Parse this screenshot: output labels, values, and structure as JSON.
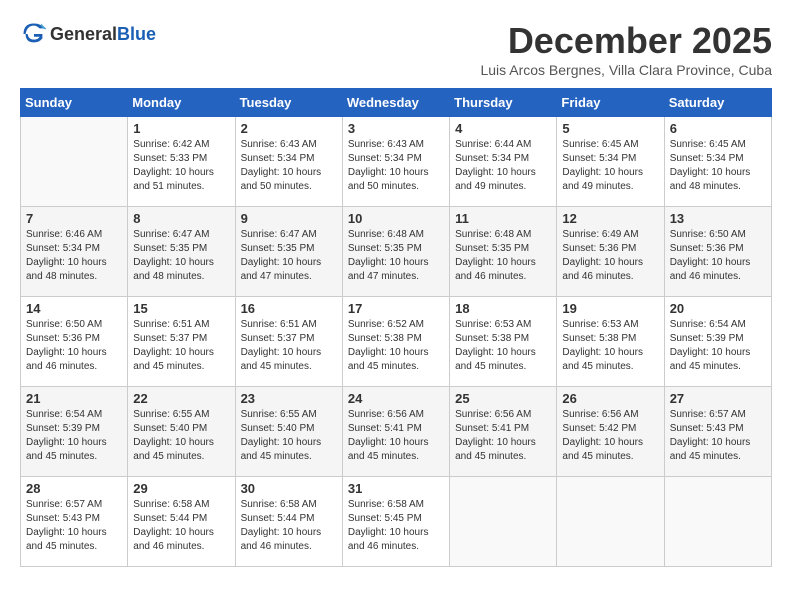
{
  "logo": {
    "text_general": "General",
    "text_blue": "Blue"
  },
  "title": {
    "month": "December 2025",
    "location": "Luis Arcos Bergnes, Villa Clara Province, Cuba"
  },
  "calendar": {
    "headers": [
      "Sunday",
      "Monday",
      "Tuesday",
      "Wednesday",
      "Thursday",
      "Friday",
      "Saturday"
    ],
    "weeks": [
      [
        {
          "day": "",
          "sunrise": "",
          "sunset": "",
          "daylight": ""
        },
        {
          "day": "1",
          "sunrise": "Sunrise: 6:42 AM",
          "sunset": "Sunset: 5:33 PM",
          "daylight": "Daylight: 10 hours and 51 minutes."
        },
        {
          "day": "2",
          "sunrise": "Sunrise: 6:43 AM",
          "sunset": "Sunset: 5:34 PM",
          "daylight": "Daylight: 10 hours and 50 minutes."
        },
        {
          "day": "3",
          "sunrise": "Sunrise: 6:43 AM",
          "sunset": "Sunset: 5:34 PM",
          "daylight": "Daylight: 10 hours and 50 minutes."
        },
        {
          "day": "4",
          "sunrise": "Sunrise: 6:44 AM",
          "sunset": "Sunset: 5:34 PM",
          "daylight": "Daylight: 10 hours and 49 minutes."
        },
        {
          "day": "5",
          "sunrise": "Sunrise: 6:45 AM",
          "sunset": "Sunset: 5:34 PM",
          "daylight": "Daylight: 10 hours and 49 minutes."
        },
        {
          "day": "6",
          "sunrise": "Sunrise: 6:45 AM",
          "sunset": "Sunset: 5:34 PM",
          "daylight": "Daylight: 10 hours and 48 minutes."
        }
      ],
      [
        {
          "day": "7",
          "sunrise": "Sunrise: 6:46 AM",
          "sunset": "Sunset: 5:34 PM",
          "daylight": "Daylight: 10 hours and 48 minutes."
        },
        {
          "day": "8",
          "sunrise": "Sunrise: 6:47 AM",
          "sunset": "Sunset: 5:35 PM",
          "daylight": "Daylight: 10 hours and 48 minutes."
        },
        {
          "day": "9",
          "sunrise": "Sunrise: 6:47 AM",
          "sunset": "Sunset: 5:35 PM",
          "daylight": "Daylight: 10 hours and 47 minutes."
        },
        {
          "day": "10",
          "sunrise": "Sunrise: 6:48 AM",
          "sunset": "Sunset: 5:35 PM",
          "daylight": "Daylight: 10 hours and 47 minutes."
        },
        {
          "day": "11",
          "sunrise": "Sunrise: 6:48 AM",
          "sunset": "Sunset: 5:35 PM",
          "daylight": "Daylight: 10 hours and 46 minutes."
        },
        {
          "day": "12",
          "sunrise": "Sunrise: 6:49 AM",
          "sunset": "Sunset: 5:36 PM",
          "daylight": "Daylight: 10 hours and 46 minutes."
        },
        {
          "day": "13",
          "sunrise": "Sunrise: 6:50 AM",
          "sunset": "Sunset: 5:36 PM",
          "daylight": "Daylight: 10 hours and 46 minutes."
        }
      ],
      [
        {
          "day": "14",
          "sunrise": "Sunrise: 6:50 AM",
          "sunset": "Sunset: 5:36 PM",
          "daylight": "Daylight: 10 hours and 46 minutes."
        },
        {
          "day": "15",
          "sunrise": "Sunrise: 6:51 AM",
          "sunset": "Sunset: 5:37 PM",
          "daylight": "Daylight: 10 hours and 45 minutes."
        },
        {
          "day": "16",
          "sunrise": "Sunrise: 6:51 AM",
          "sunset": "Sunset: 5:37 PM",
          "daylight": "Daylight: 10 hours and 45 minutes."
        },
        {
          "day": "17",
          "sunrise": "Sunrise: 6:52 AM",
          "sunset": "Sunset: 5:38 PM",
          "daylight": "Daylight: 10 hours and 45 minutes."
        },
        {
          "day": "18",
          "sunrise": "Sunrise: 6:53 AM",
          "sunset": "Sunset: 5:38 PM",
          "daylight": "Daylight: 10 hours and 45 minutes."
        },
        {
          "day": "19",
          "sunrise": "Sunrise: 6:53 AM",
          "sunset": "Sunset: 5:38 PM",
          "daylight": "Daylight: 10 hours and 45 minutes."
        },
        {
          "day": "20",
          "sunrise": "Sunrise: 6:54 AM",
          "sunset": "Sunset: 5:39 PM",
          "daylight": "Daylight: 10 hours and 45 minutes."
        }
      ],
      [
        {
          "day": "21",
          "sunrise": "Sunrise: 6:54 AM",
          "sunset": "Sunset: 5:39 PM",
          "daylight": "Daylight: 10 hours and 45 minutes."
        },
        {
          "day": "22",
          "sunrise": "Sunrise: 6:55 AM",
          "sunset": "Sunset: 5:40 PM",
          "daylight": "Daylight: 10 hours and 45 minutes."
        },
        {
          "day": "23",
          "sunrise": "Sunrise: 6:55 AM",
          "sunset": "Sunset: 5:40 PM",
          "daylight": "Daylight: 10 hours and 45 minutes."
        },
        {
          "day": "24",
          "sunrise": "Sunrise: 6:56 AM",
          "sunset": "Sunset: 5:41 PM",
          "daylight": "Daylight: 10 hours and 45 minutes."
        },
        {
          "day": "25",
          "sunrise": "Sunrise: 6:56 AM",
          "sunset": "Sunset: 5:41 PM",
          "daylight": "Daylight: 10 hours and 45 minutes."
        },
        {
          "day": "26",
          "sunrise": "Sunrise: 6:56 AM",
          "sunset": "Sunset: 5:42 PM",
          "daylight": "Daylight: 10 hours and 45 minutes."
        },
        {
          "day": "27",
          "sunrise": "Sunrise: 6:57 AM",
          "sunset": "Sunset: 5:43 PM",
          "daylight": "Daylight: 10 hours and 45 minutes."
        }
      ],
      [
        {
          "day": "28",
          "sunrise": "Sunrise: 6:57 AM",
          "sunset": "Sunset: 5:43 PM",
          "daylight": "Daylight: 10 hours and 45 minutes."
        },
        {
          "day": "29",
          "sunrise": "Sunrise: 6:58 AM",
          "sunset": "Sunset: 5:44 PM",
          "daylight": "Daylight: 10 hours and 46 minutes."
        },
        {
          "day": "30",
          "sunrise": "Sunrise: 6:58 AM",
          "sunset": "Sunset: 5:44 PM",
          "daylight": "Daylight: 10 hours and 46 minutes."
        },
        {
          "day": "31",
          "sunrise": "Sunrise: 6:58 AM",
          "sunset": "Sunset: 5:45 PM",
          "daylight": "Daylight: 10 hours and 46 minutes."
        },
        {
          "day": "",
          "sunrise": "",
          "sunset": "",
          "daylight": ""
        },
        {
          "day": "",
          "sunrise": "",
          "sunset": "",
          "daylight": ""
        },
        {
          "day": "",
          "sunrise": "",
          "sunset": "",
          "daylight": ""
        }
      ]
    ]
  }
}
